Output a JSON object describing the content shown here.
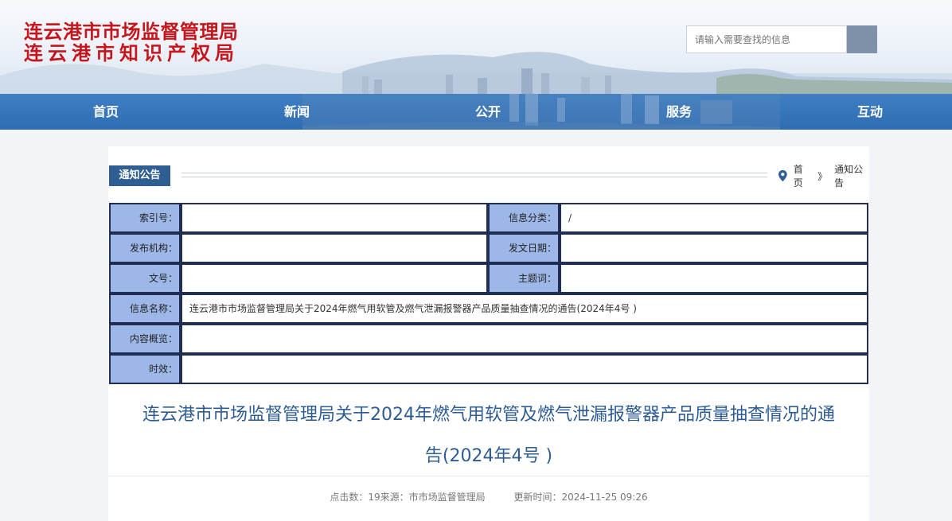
{
  "header": {
    "org_name_line1": "连云港市市场监督管理局",
    "org_name_line2": "连云港市知识产权局",
    "search_placeholder": "请输入需要查找的信息"
  },
  "nav": {
    "items": [
      "首页",
      "新闻",
      "公开",
      "服务",
      "互动"
    ]
  },
  "section": {
    "tag": "通知公告",
    "breadcrumb": [
      "首页",
      "》",
      "通知公告"
    ]
  },
  "info_table": {
    "index_label": "索引号：",
    "index_value": "",
    "category_label": "信息分类：",
    "category_value": "/",
    "publisher_label": "发布机构：",
    "publisher_value": "",
    "date_label": "发文日期：",
    "date_value": "",
    "docno_label": "文号：",
    "docno_value": "",
    "subject_label": "主题词：",
    "subject_value": "",
    "name_label": "信息名称：",
    "name_value": "连云港市市场监督管理局关于2024年燃气用软管及燃气泄漏报警器产品质量抽查情况的通告(2024年4号 )",
    "summary_label": "内容概览：",
    "summary_value": "",
    "validity_label": "时效：",
    "validity_value": ""
  },
  "article": {
    "title_line1": "连云港市市场监督管理局关于2024年燃气用软管及燃气泄漏报警器产品质量抽查情况的通",
    "title_line2": "告(2024年4号 )",
    "meta_clicks": "点击数：19来源：市市场监督管理局",
    "meta_updated": "更新时间：2024-11-25 09:26"
  },
  "colors": {
    "logo_red": "#c4161c",
    "nav_blue": "#2f6cb3",
    "tag_blue": "#2f5e92",
    "label_bg": "#9db7e8",
    "title_blue": "#2e5c95"
  }
}
